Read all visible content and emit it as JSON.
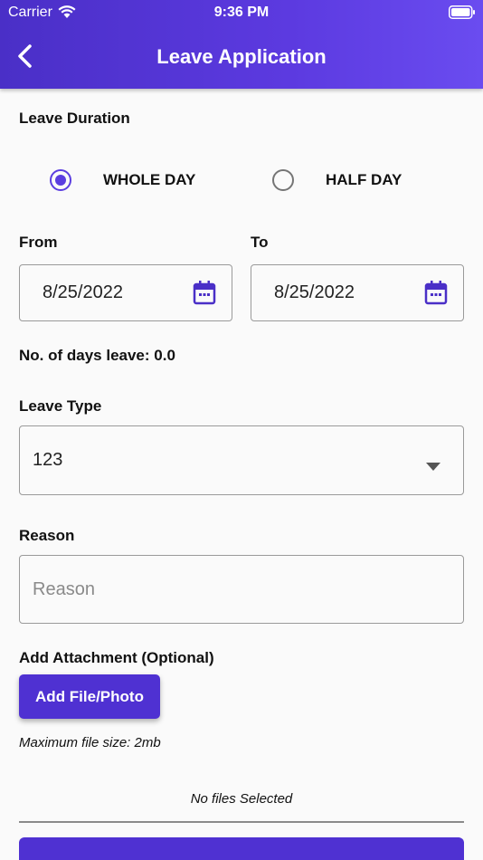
{
  "status_bar": {
    "carrier": "Carrier",
    "time": "9:36 PM"
  },
  "header": {
    "title": "Leave Application"
  },
  "leave_duration": {
    "label": "Leave Duration",
    "options": [
      {
        "label": "WHOLE DAY",
        "selected": true
      },
      {
        "label": "HALF DAY",
        "selected": false
      }
    ]
  },
  "from": {
    "label": "From",
    "value": "8/25/2022"
  },
  "to": {
    "label": "To",
    "value": "8/25/2022"
  },
  "days_leave": "No. of days leave: 0.0",
  "leave_type": {
    "label": "Leave Type",
    "value": "123"
  },
  "reason": {
    "label": "Reason",
    "placeholder": "Reason"
  },
  "attachment": {
    "label": "Add Attachment (Optional)",
    "button_label": "Add File/Photo",
    "max_size_note": "Maximum file size: 2mb",
    "files_status": "No files Selected"
  },
  "colors": {
    "accent": "#4f31d2",
    "header_start": "#4a2fc7",
    "header_end": "#6a4cf0"
  },
  "icons": [
    "wifi-icon",
    "battery-icon",
    "back-arrow-icon",
    "calendar-icon",
    "dropdown-arrow-icon"
  ]
}
